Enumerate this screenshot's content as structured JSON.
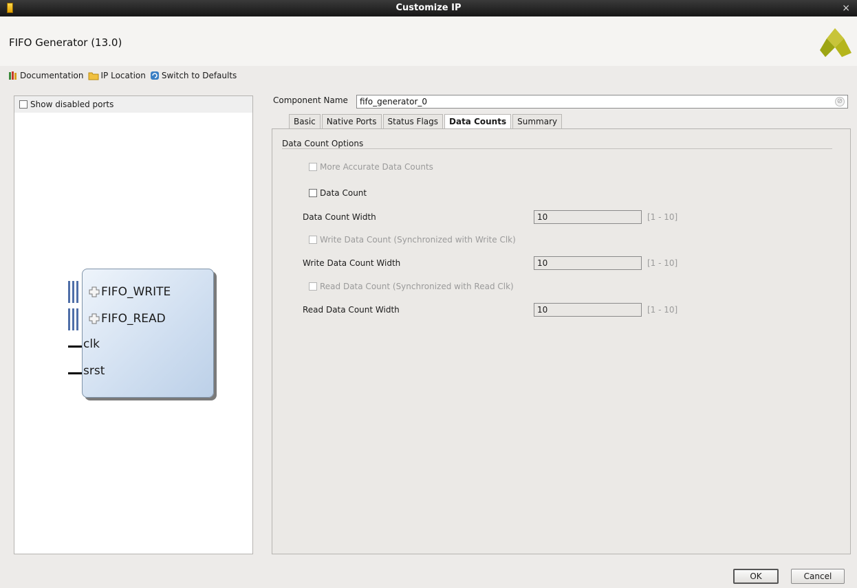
{
  "window": {
    "title": "Customize IP"
  },
  "header": {
    "ip_name": "FIFO Generator (13.0)"
  },
  "toolbar": {
    "documentation": "Documentation",
    "ip_location": "IP Location",
    "switch_defaults": "Switch to Defaults"
  },
  "left_panel": {
    "show_disabled_ports": "Show disabled ports",
    "ports": {
      "fifo_write": "FIFO_WRITE",
      "fifo_read": "FIFO_READ",
      "clk": "clk",
      "srst": "srst"
    }
  },
  "component": {
    "label": "Component Name",
    "value": "fifo_generator_0"
  },
  "tabs": [
    {
      "label": "Basic"
    },
    {
      "label": "Native Ports"
    },
    {
      "label": "Status Flags"
    },
    {
      "label": "Data Counts",
      "active": true
    },
    {
      "label": "Summary"
    }
  ],
  "data_counts": {
    "section_title": "Data Count Options",
    "more_accurate": "More Accurate Data Counts",
    "data_count": "Data Count",
    "data_count_width_label": "Data Count Width",
    "data_count_width_value": "10",
    "write_data_count": "Write Data Count (Synchronized with Write Clk)",
    "write_data_count_width_label": "Write Data Count Width",
    "write_data_count_width_value": "10",
    "read_data_count": "Read Data Count (Synchronized with Read Clk)",
    "read_data_count_width_label": "Read Data Count Width",
    "read_data_count_width_value": "10",
    "range": "[1 - 10]"
  },
  "buttons": {
    "ok": "OK",
    "cancel": "Cancel"
  },
  "colors": {
    "titlebar": "#161616",
    "block_fill": "#cfdef0",
    "bus": "#4f6fa8",
    "logo": "#b5b51c"
  }
}
